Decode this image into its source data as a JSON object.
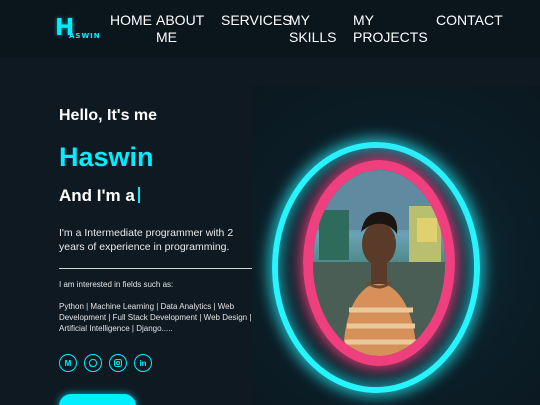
{
  "nav": {
    "logo_letter": "H",
    "logo_text": "ASWIN",
    "items": [
      {
        "label": "HOME"
      },
      {
        "label": "ABOUT\nME"
      },
      {
        "label": "SERVICES"
      },
      {
        "label": "MY\nSKILLS"
      },
      {
        "label": "MY\nPROJECTS"
      },
      {
        "label": "CONTACT"
      }
    ]
  },
  "hero": {
    "greeting": "Hello, It's me",
    "name": "Haswin",
    "role_prefix": "And I'm a",
    "description": "I'm a Intermediate programmer with 2 years of experience in programming.",
    "interest_label": "I am interested in fields such as:",
    "fields": "Python | Machine Learning | Data Analytics | Web Development | Full Stack Development | Web Design | Artificial Intelligence | Django.....",
    "socials": [
      {
        "icon": "gmail-icon",
        "glyph": "M"
      },
      {
        "icon": "whatsapp-icon",
        "glyph": ""
      },
      {
        "icon": "instagram-icon",
        "glyph": ""
      },
      {
        "icon": "linkedin-icon",
        "glyph": "in"
      }
    ]
  },
  "colors": {
    "accent": "#00eeff",
    "ring_inner": "#f03f7e",
    "background": "#0f1922"
  }
}
